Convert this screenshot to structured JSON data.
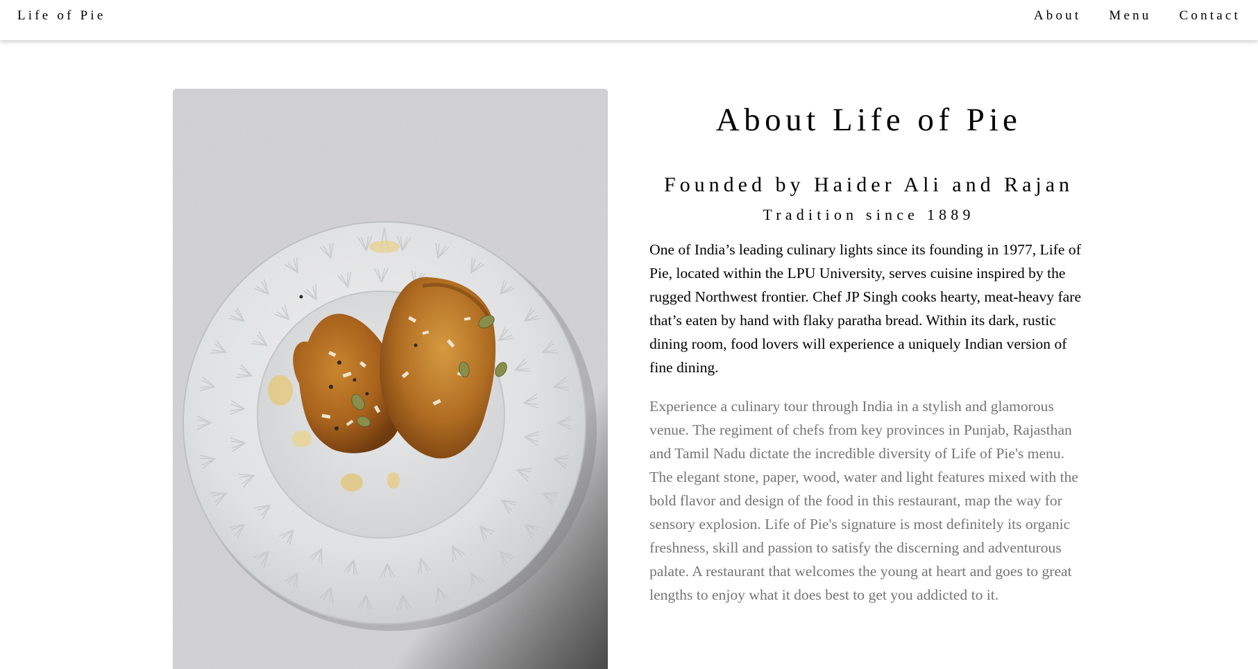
{
  "header": {
    "brand": "Life of Pie",
    "nav": [
      {
        "label": "About"
      },
      {
        "label": "Menu"
      },
      {
        "label": "Contact"
      }
    ]
  },
  "about": {
    "title": "About Life of Pie",
    "subtitle": "Founded by Haider Ali and Rajan",
    "tagline": "Tradition since 1889",
    "paragraph1": "One of India’s leading culinary lights since its founding in 1977, Life of Pie, located within the LPU University, serves cuisine inspired by the rugged Northwest frontier. Chef JP Singh cooks hearty, meat-heavy fare that’s eaten by hand with flaky paratha bread. Within its dark, rustic dining room, food lovers will experience a uniquely Indian version of fine dining.",
    "paragraph2": "Experience a culinary tour through India in a stylish and glamorous venue. The regiment of chefs from key provinces in Punjab, Rajasthan and Tamil Nadu dictate the incredible diversity of Life of Pie's menu. The elegant stone, paper, wood, water and light features mixed with the bold flavor and design of the food in this restaurant, map the way for sensory explosion. Life of Pie's signature is most definitely its organic freshness, skill and passion to satisfy the discerning and adventurous palate. A restaurant that welcomes the young at heart and goes to great lengths to enjoy what it does best to get you addicted to it."
  },
  "colors": {
    "text": "#000000",
    "muted_text": "#757575",
    "background": "#ffffff"
  }
}
